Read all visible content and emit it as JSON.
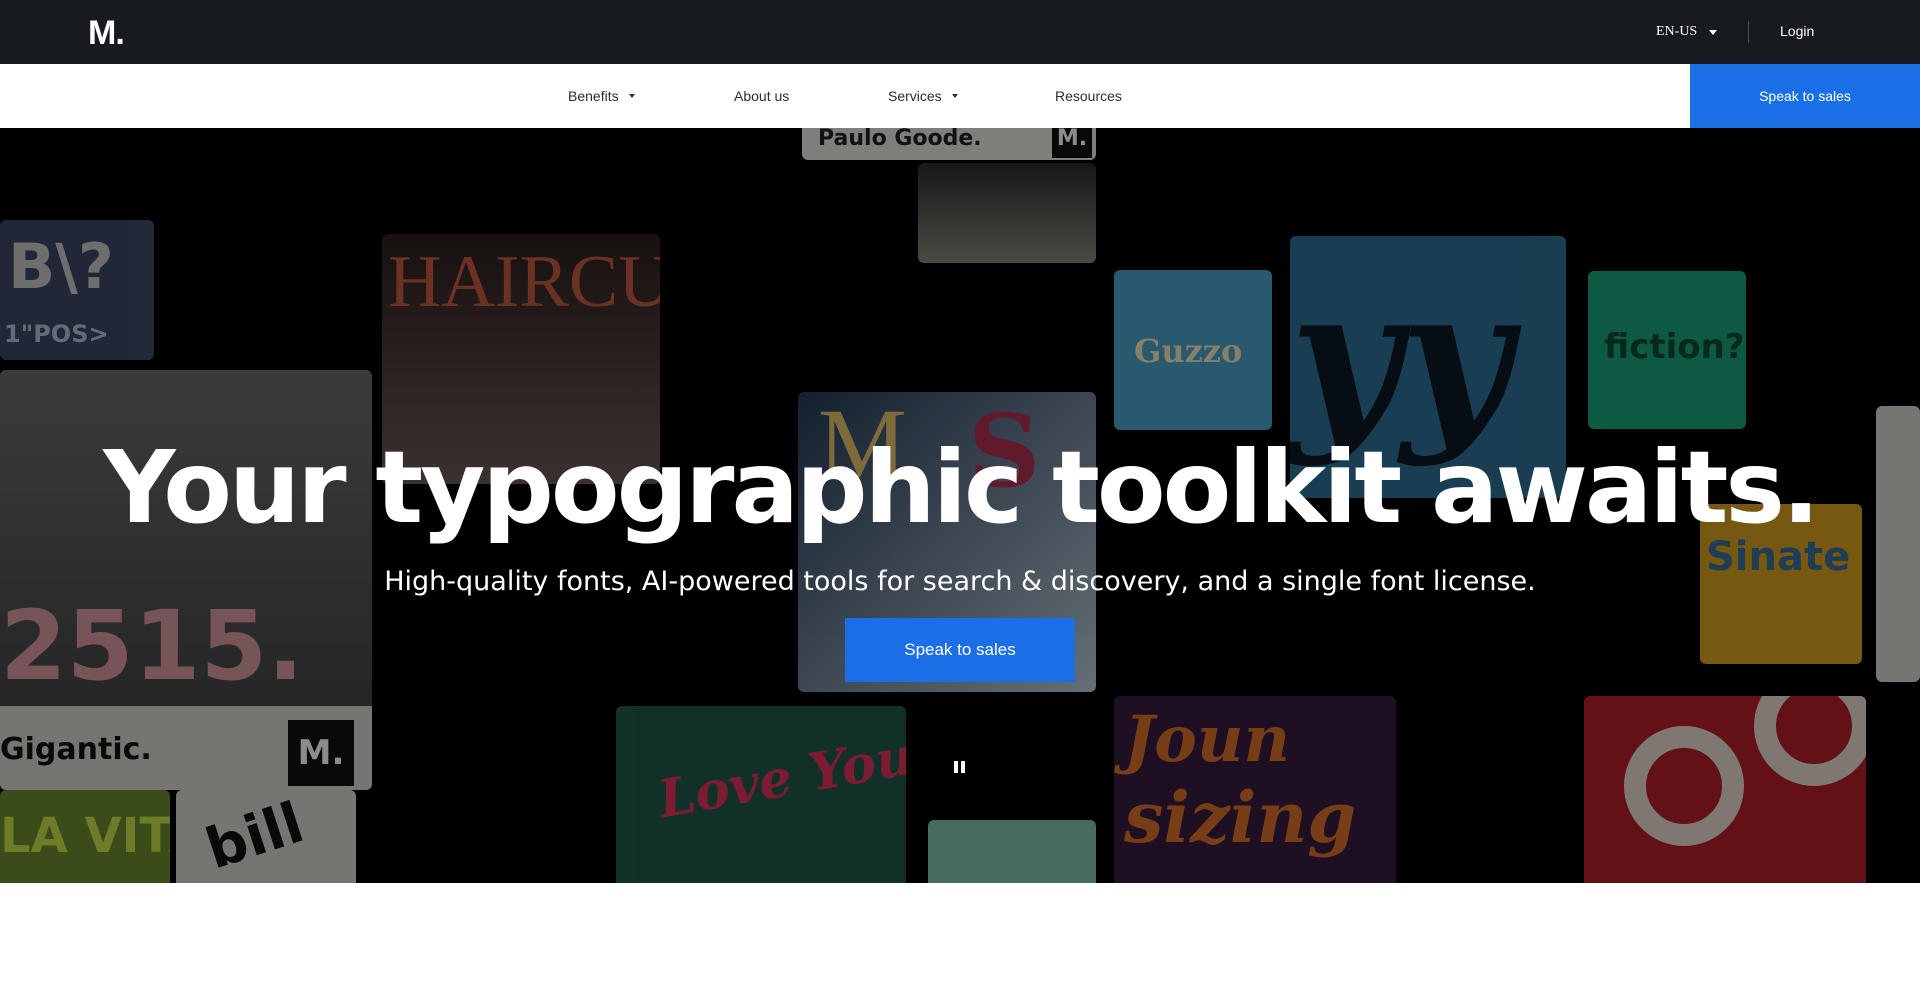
{
  "brand": {
    "logo": "M."
  },
  "topbar": {
    "language": "EN-US",
    "login": "Login"
  },
  "nav": {
    "items": [
      {
        "label": "Benefits",
        "has_dropdown": true
      },
      {
        "label": "About us",
        "has_dropdown": false
      },
      {
        "label": "Services",
        "has_dropdown": true
      },
      {
        "label": "Resources",
        "has_dropdown": false
      }
    ],
    "cta": "Speak to sales"
  },
  "hero": {
    "title": "Your typographic toolkit awaits.",
    "subtitle": "High-quality fonts, AI-powered tools for search & discovery, and a single font license.",
    "cta": "Speak to sales",
    "pause_icon": "pause-icon",
    "tiles": [
      {
        "text": "Paulo Goode.",
        "badge": "M."
      },
      {
        "text": "HAIRCU"
      },
      {
        "text": "Guzzo"
      },
      {
        "text": "fiction?"
      },
      {
        "text": "Gigantic.",
        "badge": "M."
      },
      {
        "text": "Love Yourself"
      },
      {
        "text": "sizing"
      },
      {
        "text": "2515."
      }
    ]
  },
  "colors": {
    "topbar": "#171a1e",
    "accent": "#1a6fe6",
    "nav_bg": "#ffffff",
    "hero_bg": "#000000"
  }
}
